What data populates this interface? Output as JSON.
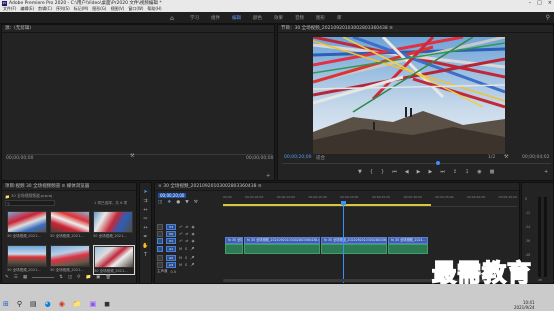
{
  "titlebar": {
    "app_icon": "Pr",
    "title": "Adobe Premiere Pro 2020 - C:\\用户\\Video\\桌面\\Pr2020   文件\\视频编辑 *"
  },
  "menubar": [
    "文件(F)",
    "编辑(E)",
    "剪辑(C)",
    "序列(S)",
    "标记(M)",
    "图形(G)",
    "视图(V)",
    "窗口(W)",
    "帮助(H)"
  ],
  "workspace": {
    "tabs": [
      "学习",
      "组件",
      "编辑",
      "颜色",
      "效果",
      "音频",
      "图形",
      "库"
    ],
    "active_index": 2
  },
  "source_panel": {
    "title": "源：(无剪辑)",
    "tc_left": "00;00;00;00",
    "tc_right": "00;00;00;00"
  },
  "program_panel": {
    "title": "节目：30 全场视频_20210920103002803360438 ≡",
    "tc_left": "00;00;20;00",
    "fit": "适合",
    "quality": "1/2",
    "tc_right": "00;00;04;02"
  },
  "project_panel": {
    "title": "项目:视频  30 全场视频频道 ≡    媒体浏览器",
    "file": "30 全场视频频道.prproj",
    "search_placeholder": "",
    "count": "1 项已选择，共 6 项",
    "items": [
      {
        "label": "30 全场视频_2021..."
      },
      {
        "label": "30 全场视频_2021..."
      },
      {
        "label": "30 全场视频_2021..."
      },
      {
        "label": "30 全场视频_2021..."
      },
      {
        "label": "30 全场视频_2021..."
      },
      {
        "label": "30 全场视频_2021..."
      }
    ]
  },
  "timeline": {
    "tab": "30 全场视频_20210920103002803360438 ≡",
    "timecode": "00;00;20;00",
    "ruler": [
      "00;00",
      "00;00;05;00",
      "00;00;10;00",
      "00;00;15;00",
      "00;00;20;00",
      "00;00;25;00",
      "00;00;30;00",
      "00;00;35;00",
      "00;00;40;00",
      "00;00;45;00"
    ],
    "video_tracks": [
      "V3",
      "V2",
      "V1"
    ],
    "audio_tracks": [
      "A1",
      "A2",
      "A3"
    ],
    "mix_label": "主声道",
    "mix_value": "0.0",
    "clip_labels": [
      "fx  30 全场视频_2021...",
      "fx  30 全场视频_20210920103002803360438.mp4",
      "fx  30 全场视频_20210920103002803360438.mp4",
      "fx  30 全场视频_2021..."
    ]
  },
  "meter_labels": [
    "0",
    "-12",
    "-24",
    "-36",
    "-48",
    "dB"
  ],
  "watermark": "最需教育",
  "taskbar": {
    "time": "10:41",
    "date": "2021/9/24"
  },
  "colors": {
    "accent": "#5a9bf0",
    "playhead": "#3a8fff",
    "video_clip": "#3f5fb0",
    "audio_clip": "#2e7a55",
    "watermark": "#1a4fd0"
  }
}
